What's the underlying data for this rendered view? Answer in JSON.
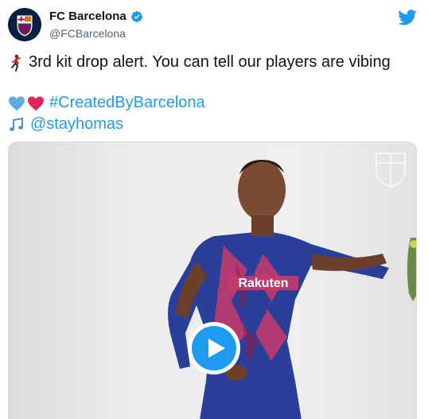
{
  "colors": {
    "accent": "#1d9bf0",
    "text": "#0f1419",
    "secondary_text": "#536471",
    "heart_blue": "#5dade2",
    "heart_red": "#e0245e"
  },
  "header": {
    "display_name": "FC Barcelona",
    "handle": "@FCBarcelona",
    "avatar_icon": "fc-barcelona-crest",
    "verified_icon": "verified-badge-icon",
    "platform_icon": "twitter-bird-icon"
  },
  "tweet": {
    "line1_emoji": "dancing-man",
    "line1_text": "3rd kit drop alert. You can tell our players are vibing",
    "line2_emojis": [
      "blue-heart",
      "red-heart"
    ],
    "hashtag": "#CreatedByBarcelona",
    "line3_emoji": "musical-notes",
    "mention": "@stayhomas"
  },
  "media": {
    "type": "video",
    "play_icon": "play-icon"
  }
}
